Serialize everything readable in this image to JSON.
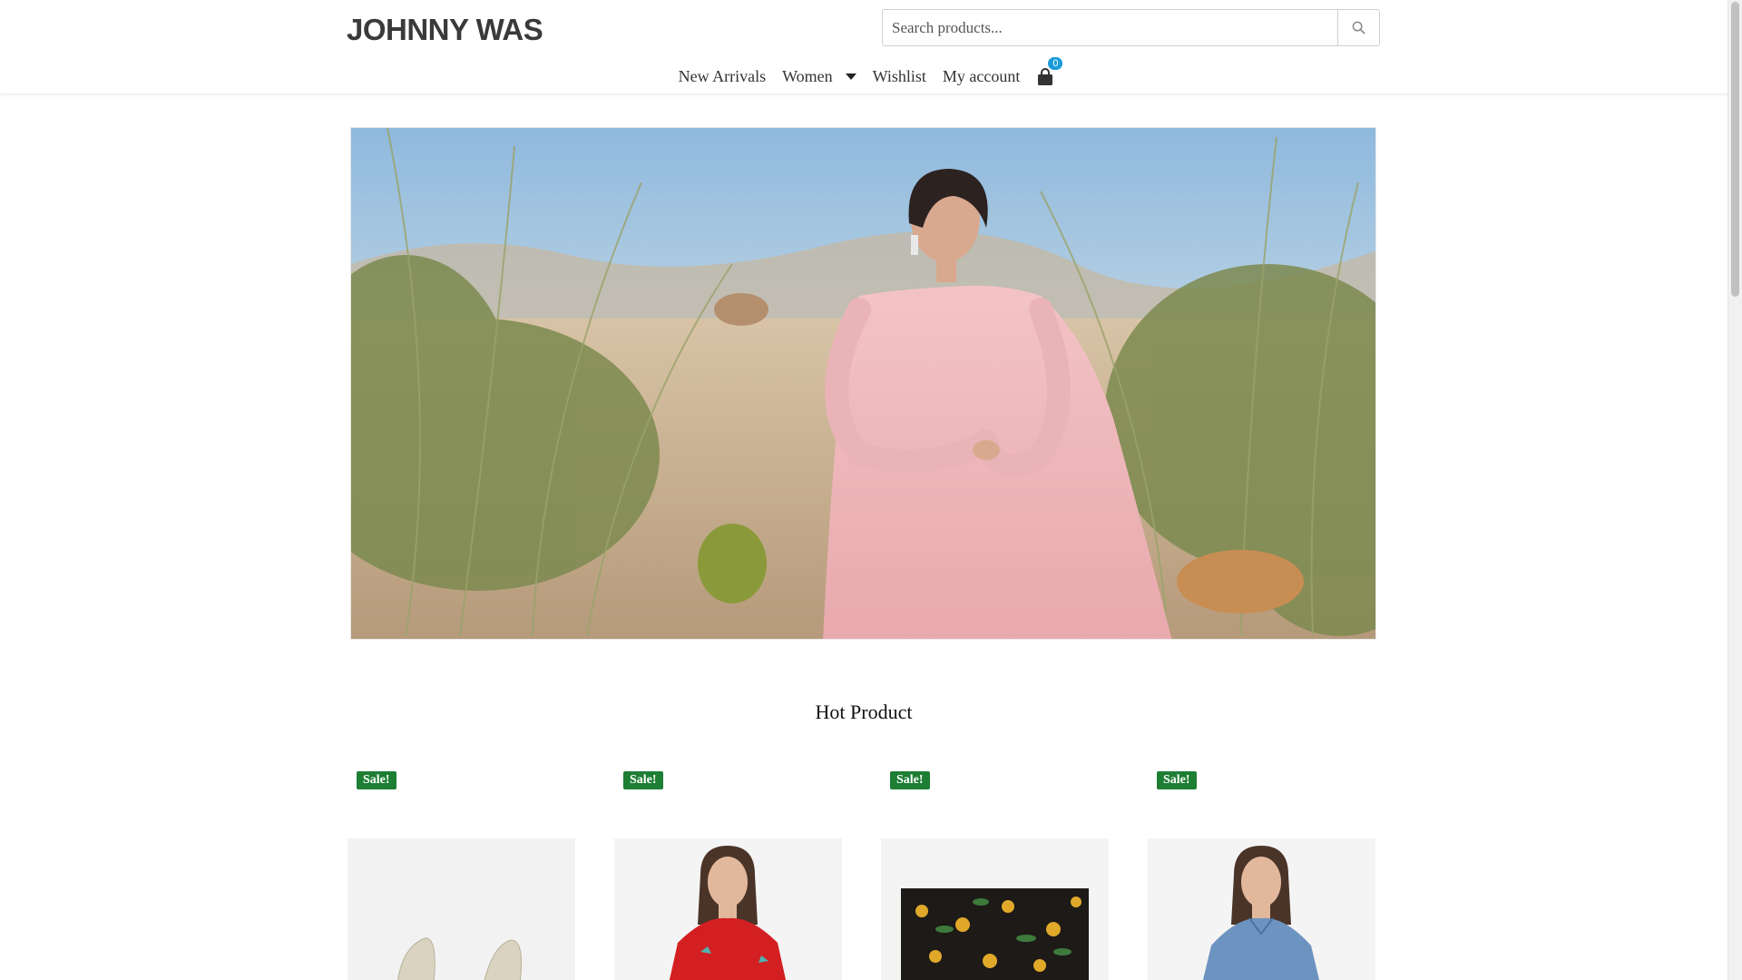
{
  "brand": {
    "logo_text": "JOHNNY WAS"
  },
  "search": {
    "placeholder": "Search products...",
    "value": "",
    "button_icon": "search-icon"
  },
  "nav": {
    "items": [
      {
        "label": "New Arrivals"
      },
      {
        "label": "Women",
        "has_dropdown": true
      },
      {
        "label": "Wishlist"
      },
      {
        "label": "My account"
      }
    ],
    "cart": {
      "icon": "shopping-bag-icon",
      "count": "0"
    }
  },
  "hero": {
    "image": "desert-woman-pink-dress"
  },
  "hot_products": {
    "title": "Hot Product",
    "items": [
      {
        "badge": "Sale!",
        "image": "sandals"
      },
      {
        "badge": "Sale!",
        "image": "red-embroidered-top"
      },
      {
        "badge": "Sale!",
        "image": "floral-scarf"
      },
      {
        "badge": "Sale!",
        "image": "denim-shirt"
      }
    ]
  },
  "colors": {
    "accent": "#1a9bd7",
    "sale_badge": "#1e7e34",
    "text": "#333333"
  }
}
